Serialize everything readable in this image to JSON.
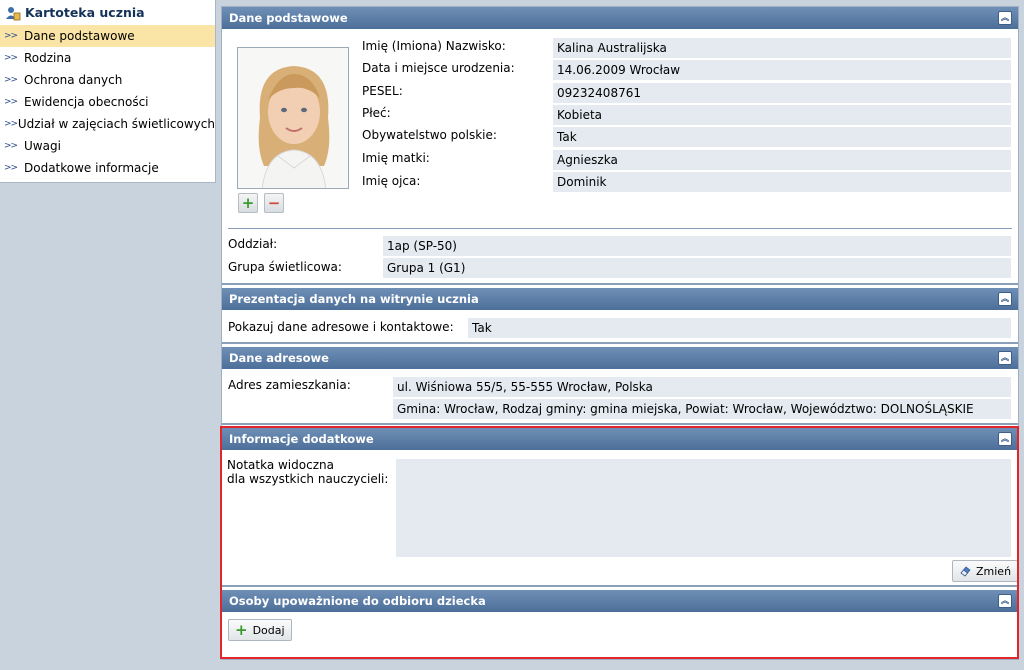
{
  "sidebar": {
    "title": "Kartoteka ucznia",
    "items": [
      {
        "label": "Dane podstawowe",
        "active": true
      },
      {
        "label": "Rodzina"
      },
      {
        "label": "Ochrona danych"
      },
      {
        "label": "Ewidencja obecności"
      },
      {
        "label": "Udział w zajęciach świetlicowych"
      },
      {
        "label": "Uwagi"
      },
      {
        "label": "Dodatkowe informacje"
      }
    ]
  },
  "sections": {
    "basic": {
      "title": "Dane podstawowe",
      "fields": [
        {
          "label": "Imię (Imiona) Nazwisko:",
          "value": "Kalina Australijska"
        },
        {
          "label": "Data i miejsce urodzenia:",
          "value": "14.06.2009 Wrocław"
        },
        {
          "label": "PESEL:",
          "value": "09232408761"
        },
        {
          "label": "Płeć:",
          "value": "Kobieta"
        },
        {
          "label": "Obywatelstwo polskie:",
          "value": "Tak"
        },
        {
          "label": "Imię matki:",
          "value": "Agnieszka"
        },
        {
          "label": "Imię ojca:",
          "value": "Dominik"
        }
      ],
      "extra": [
        {
          "label": "Oddział:",
          "value": "1ap (SP-50)"
        },
        {
          "label": "Grupa świetlicowa:",
          "value": "Grupa 1 (G1)"
        }
      ]
    },
    "presentation": {
      "title": "Prezentacja danych na witrynie ucznia",
      "label": "Pokazuj dane adresowe i kontaktowe:",
      "value": "Tak"
    },
    "address": {
      "title": "Dane adresowe",
      "label": "Adres zamieszkania:",
      "line1": "ul. Wiśniowa 55/5, 55-555 Wrocław, Polska",
      "line2": "Gmina: Wrocław, Rodzaj gminy: gmina miejska, Powiat: Wrocław, Województwo: DOLNOŚLĄSKIE"
    },
    "info": {
      "title": "Informacje dodatkowe",
      "note_label_1": "Notatka widoczna",
      "note_label_2": "dla wszystkich nauczycieli:",
      "note_value": "",
      "edit_button": "Zmień"
    },
    "pickup": {
      "title": "Osoby upoważnione do odbioru dziecka",
      "add_button": "Dodaj"
    }
  },
  "colors": {
    "header": "#5a7ca6",
    "highlight": "#e0262a",
    "active_nav": "#fbe5a6",
    "value_bg": "#e4eaf0"
  },
  "icons": {
    "nav_header": "student-card-icon",
    "nav_item": "double-chevron-right-icon",
    "collapse": "double-chevron-up-icon",
    "add_photo": "plus-icon",
    "remove_photo": "minus-icon",
    "edit": "eraser-icon",
    "add": "plus-icon"
  }
}
